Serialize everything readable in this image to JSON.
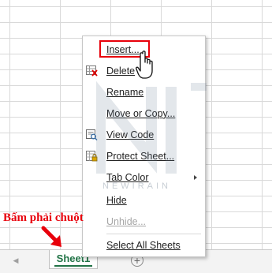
{
  "menu": {
    "items": [
      {
        "label": "Insert...",
        "icon": "",
        "disabled": false,
        "submenu": false
      },
      {
        "label": "Delete",
        "icon": "delete-sheet-icon",
        "disabled": false,
        "submenu": false
      },
      {
        "label": "Rename",
        "icon": "",
        "disabled": false,
        "submenu": false
      },
      {
        "label": "Move or Copy...",
        "icon": "",
        "disabled": false,
        "submenu": false
      },
      {
        "label": "View Code",
        "icon": "view-code-icon",
        "disabled": false,
        "submenu": false
      },
      {
        "label": "Protect Sheet...",
        "icon": "protect-sheet-icon",
        "disabled": false,
        "submenu": false
      },
      {
        "label": "Tab Color",
        "icon": "",
        "disabled": false,
        "submenu": true
      },
      {
        "label": "Hide",
        "icon": "",
        "disabled": false,
        "submenu": false
      },
      {
        "label": "Unhide...",
        "icon": "",
        "disabled": true,
        "submenu": false
      },
      {
        "label": "Select All Sheets",
        "icon": "",
        "disabled": false,
        "submenu": false
      }
    ]
  },
  "sheet_tab": {
    "label": "Sheet1"
  },
  "annotation": {
    "text": "Bấm phải chuột"
  },
  "watermark": {
    "text": "NEWIRAIN"
  },
  "colors": {
    "highlight": "#e8000b",
    "excel_green": "#217346",
    "disabled": "#a6a6a6"
  }
}
